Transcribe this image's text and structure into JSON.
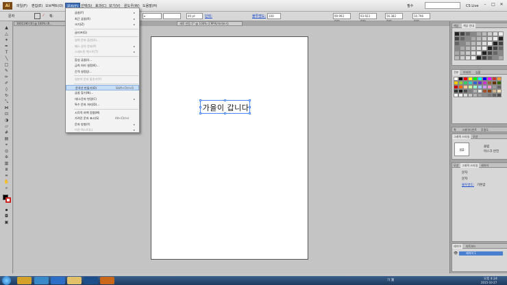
{
  "app": {
    "logo": "Ai"
  },
  "menubar": {
    "items": [
      "파일(F)",
      "편집(E)",
      "오브젝트(O)",
      "문자(T)",
      "선택(S)",
      "효과(C)",
      "보기(V)",
      "윈도우(W)",
      "도움말(H)"
    ],
    "active_index": 3,
    "workspace": "필수",
    "cs_live": "CS Live"
  },
  "controlbar": {
    "label": "문자",
    "fill_color": "#000000",
    "stroke_label": "획:",
    "opacity_label": "불투명도:",
    "opacity_value": "100",
    "font_size": "40 pt",
    "paragraph_label": "단락:",
    "field_x": "99.993 mm",
    "field_y": "93.923 mm",
    "field_w": "56.382 mm",
    "field_h": "10.796 mm"
  },
  "tabs": [
    {
      "label": "3001190 [0] @ 100% (R..."
    },
    {
      "label": "새로 만듬-1* @ 100% (CMYK/미리보기)"
    }
  ],
  "dropdown": {
    "items": [
      {
        "label": "글꼴(F)",
        "arrow": "▸",
        "disabled": false
      },
      {
        "label": "최근 글꼴(R)",
        "arrow": "▸",
        "disabled": false
      },
      {
        "label": "크기(Z)",
        "arrow": "▸",
        "disabled": false
      },
      {
        "label": "글리프(G)",
        "disabled": false
      },
      {
        "label": "영역 문자 옵션(A)...",
        "disabled": true
      },
      {
        "label": "패스 상의 문자(P)",
        "arrow": "▸",
        "disabled": true
      },
      {
        "label": "스레드된 텍스트(T)",
        "arrow": "▸",
        "disabled": true
      },
      {
        "label": "합성 글꼴(I)...",
        "disabled": false
      },
      {
        "label": "금칙 처리 설정(K)...",
        "disabled": false
      },
      {
        "label": "간격 설정(J)...",
        "disabled": false
      },
      {
        "label": "일본어 문자 맞추기(Y)",
        "disabled": true
      },
      {
        "label": "윤곽선 만들기(O)",
        "shortcut": "Shift+Ctrl+O",
        "disabled": false,
        "highlight": true
      },
      {
        "label": "글꼴 찾기(N)...",
        "disabled": false
      },
      {
        "label": "대/소문자 변경(C)",
        "arrow": "▸",
        "disabled": false
      },
      {
        "label": "특수 문자 처리(D)...",
        "disabled": false
      },
      {
        "label": "시각적 여백 정렬(M)",
        "disabled": false
      },
      {
        "label": "가려진 문자 표시(S)",
        "shortcut": "Alt+Ctrl+I",
        "disabled": false
      },
      {
        "label": "문자 방향(Y)",
        "arrow": "▸",
        "disabled": false
      },
      {
        "label": "이전 텍스트(L)",
        "arrow": "▸",
        "disabled": true
      }
    ]
  },
  "canvas": {
    "text_object": "가을이 갑니다"
  },
  "panels": {
    "color": {
      "tabs": [
        "색상",
        "색상 안내"
      ]
    },
    "swatches": {
      "tabs": [
        "견본",
        "브러쉬",
        "심볼"
      ]
    },
    "stroke": {
      "tabs": [
        "획",
        "그레이디언트",
        "투명도"
      ]
    },
    "graphic_styles": {
      "tabs": [
        "그래픽 스타일",
        "모양"
      ],
      "style_label": "샘플",
      "checkbox_a": "클립",
      "checkbox_b": "마스크 반전"
    },
    "appearance": {
      "tabs": [
        "모양",
        "그래픽 스타일",
        "레이어"
      ],
      "title": "문자",
      "row1": "문자",
      "row2_link": "불투명도:",
      "row2_value": "기본값"
    },
    "layers": {
      "tabs": [
        "레이어",
        "아트보드"
      ],
      "layer_name": "레이어 1"
    }
  },
  "taskbar": {
    "lang": "가 漢",
    "time": "오후 4:24",
    "date": "2015-10-27"
  },
  "colors": {
    "menu_active": "#3d6fb6",
    "highlight": "#c7dcf5",
    "selection": "#4a86ff",
    "taskbar": "#1f3a5e"
  }
}
